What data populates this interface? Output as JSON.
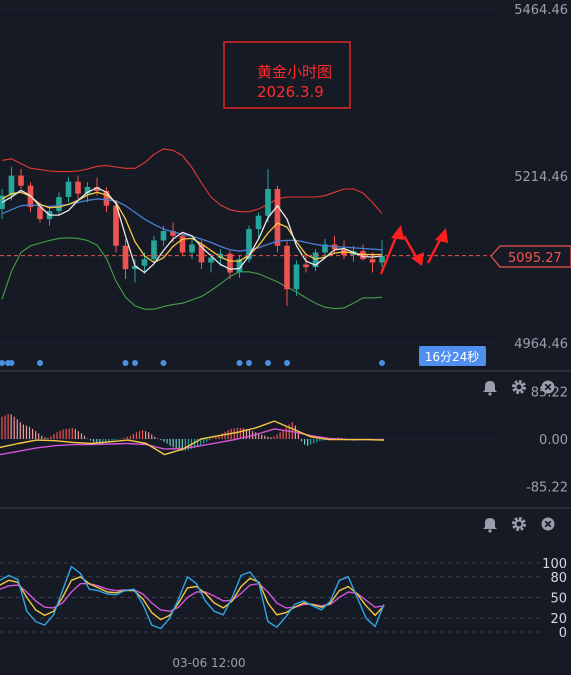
{
  "chart_data": [
    {
      "type": "candlestick",
      "panel": "main",
      "annotation": {
        "line1": "黄金小时图",
        "line2": "2026.3.9"
      },
      "y_ticks": [
        "5464.46",
        "5214.46",
        "4964.46"
      ],
      "y_tick_values": [
        5464.46,
        5214.46,
        4964.46
      ],
      "ylim": [
        4964.46,
        5464.46
      ],
      "price_label": "5095.27",
      "price_value": 5095.27,
      "countdown": "16分24秒",
      "colors": {
        "up": "#26a69a",
        "down": "#ef5350",
        "price_line": "#ef5350",
        "bb_outer": "#e53935",
        "bb_lower": "#43a047",
        "ma_fast": "#e8e8e8",
        "ma_mid": "#f5c842",
        "ma_slow": "#4a7fd6",
        "marker": "#4a90e2"
      },
      "series": [
        {
          "role": "bollinger-upper",
          "values": [
            5238,
            5240,
            5233,
            5226,
            5224,
            5222,
            5221,
            5221,
            5222,
            5225,
            5229,
            5230,
            5228,
            5226,
            5226,
            5234,
            5247,
            5255,
            5253,
            5245,
            5227,
            5204,
            5183,
            5171,
            5164,
            5161,
            5161,
            5165,
            5172,
            5180,
            5183,
            5183,
            5183,
            5183,
            5185,
            5190,
            5195,
            5195,
            5189,
            5175,
            5158
          ]
        },
        {
          "role": "bollinger-lower",
          "values": [
            5030,
            5072,
            5100,
            5110,
            5114,
            5118,
            5121,
            5122,
            5121,
            5118,
            5111,
            5091,
            5057,
            5033,
            5020,
            5015,
            5015,
            5019,
            5022,
            5024,
            5029,
            5034,
            5043,
            5053,
            5064,
            5071,
            5071,
            5068,
            5062,
            5056,
            5048,
            5041,
            5032,
            5024,
            5018,
            5016,
            5017,
            5024,
            5032,
            5032,
            5033
          ]
        },
        {
          "role": "ma-fast",
          "values": [
            5175,
            5183,
            5193,
            5185,
            5169,
            5156,
            5156,
            5163,
            5178,
            5190,
            5197,
            5190,
            5173,
            5125,
            5080,
            5070,
            5083,
            5103,
            5120,
            5130,
            5125,
            5108,
            5095,
            5082,
            5075,
            5076,
            5095,
            5120,
            5152,
            5170,
            5150,
            5110,
            5087,
            5081,
            5092,
            5104,
            5106,
            5100,
            5094,
            5093,
            5095
          ]
        },
        {
          "role": "ma-mid",
          "values": [
            5180,
            5188,
            5190,
            5184,
            5172,
            5167,
            5168,
            5172,
            5178,
            5186,
            5190,
            5186,
            5175,
            5150,
            5116,
            5095,
            5085,
            5092,
            5109,
            5120,
            5121,
            5113,
            5103,
            5093,
            5087,
            5087,
            5096,
            5110,
            5129,
            5144,
            5138,
            5116,
            5097,
            5090,
            5093,
            5099,
            5101,
            5099,
            5097,
            5097,
            5097
          ]
        },
        {
          "role": "ma-slow",
          "values": [
            5158,
            5164,
            5170,
            5171,
            5170,
            5169,
            5170,
            5172,
            5175,
            5178,
            5180,
            5179,
            5177,
            5170,
            5160,
            5150,
            5142,
            5135,
            5131,
            5127,
            5124,
            5120,
            5115,
            5109,
            5104,
            5102,
            5104,
            5107,
            5112,
            5117,
            5118,
            5118,
            5115,
            5112,
            5110,
            5109,
            5108,
            5107,
            5106,
            5105,
            5104
          ]
        }
      ],
      "candles": [
        [
          5165,
          5195,
          5150,
          5185
        ],
        [
          5185,
          5228,
          5178,
          5215
        ],
        [
          5215,
          5225,
          5195,
          5200
        ],
        [
          5200,
          5205,
          5160,
          5168
        ],
        [
          5168,
          5175,
          5145,
          5150
        ],
        [
          5150,
          5168,
          5140,
          5162
        ],
        [
          5162,
          5190,
          5155,
          5183
        ],
        [
          5183,
          5213,
          5175,
          5206
        ],
        [
          5206,
          5215,
          5180,
          5188
        ],
        [
          5188,
          5205,
          5175,
          5198
        ],
        [
          5198,
          5212,
          5185,
          5192
        ],
        [
          5192,
          5198,
          5160,
          5170
        ],
        [
          5170,
          5178,
          5100,
          5110
        ],
        [
          5110,
          5120,
          5060,
          5075
        ],
        [
          5075,
          5090,
          5055,
          5080
        ],
        [
          5080,
          5100,
          5068,
          5090
        ],
        [
          5090,
          5125,
          5085,
          5118
        ],
        [
          5118,
          5140,
          5110,
          5132
        ],
        [
          5132,
          5145,
          5115,
          5125
        ],
        [
          5125,
          5130,
          5095,
          5100
        ],
        [
          5100,
          5120,
          5090,
          5112
        ],
        [
          5112,
          5118,
          5075,
          5085
        ],
        [
          5085,
          5098,
          5070,
          5092
        ],
        [
          5092,
          5105,
          5080,
          5098
        ],
        [
          5098,
          5102,
          5060,
          5070
        ],
        [
          5070,
          5095,
          5062,
          5090
        ],
        [
          5090,
          5140,
          5085,
          5135
        ],
        [
          5135,
          5160,
          5120,
          5155
        ],
        [
          5155,
          5225,
          5145,
          5195
        ],
        [
          5195,
          5200,
          5100,
          5110
        ],
        [
          5110,
          5118,
          5020,
          5045
        ],
        [
          5045,
          5088,
          5035,
          5082
        ],
        [
          5082,
          5095,
          5070,
          5078
        ],
        [
          5078,
          5105,
          5072,
          5100
        ],
        [
          5100,
          5120,
          5092,
          5112
        ],
        [
          5112,
          5125,
          5100,
          5105
        ],
        [
          5105,
          5118,
          5090,
          5096
        ],
        [
          5096,
          5110,
          5086,
          5102
        ],
        [
          5102,
          5112,
          5088,
          5090
        ],
        [
          5090,
          5100,
          5070,
          5085
        ],
        [
          5085,
          5118,
          5078,
          5095
        ]
      ],
      "markers_at": [
        0,
        1,
        4,
        13,
        14,
        17,
        25,
        26,
        28,
        30,
        40
      ]
    },
    {
      "type": "histogram",
      "panel": "macd",
      "y_ticks": [
        "85.22",
        "0.00",
        "-85.22"
      ],
      "y_tick_values": [
        85.22,
        0,
        -85.22
      ],
      "ylim": [
        -120,
        120
      ],
      "series": [
        {
          "role": "macd-histogram",
          "values": [
            40,
            42,
            45,
            44,
            40,
            35,
            30,
            26,
            24,
            22,
            18,
            14,
            10,
            6,
            3,
            2,
            5,
            9,
            12,
            15,
            17,
            18,
            19,
            20,
            18,
            14,
            10,
            6,
            1,
            -3,
            -6,
            -8,
            -10,
            -9,
            -7,
            -5,
            -3,
            -2,
            -1,
            1,
            2,
            4,
            6,
            9,
            12,
            14,
            16,
            14,
            12,
            8,
            4,
            1,
            -2,
            -5,
            -8,
            -12,
            -15,
            -18,
            -20,
            -21,
            -21,
            -20,
            -18,
            -16,
            -14,
            -11,
            -8,
            -5,
            -2,
            1,
            4,
            7,
            10,
            13,
            16,
            18,
            19,
            20,
            20,
            19,
            18,
            16,
            14,
            12,
            10,
            8,
            6,
            4,
            3,
            5,
            8,
            12,
            17,
            22,
            26,
            30,
            24,
            10,
            -4,
            -10,
            -12,
            -10,
            -8,
            -6,
            -4,
            -3,
            -2,
            -1,
            1,
            2,
            3,
            2,
            1,
            -1,
            -2,
            -3,
            -3,
            -2,
            -1,
            0,
            1,
            1,
            0,
            -1,
            -1,
            0
          ]
        },
        {
          "role": "macd-line",
          "values": [
            -15,
            -8,
            -2,
            -3,
            -6,
            -8,
            -5,
            -2,
            -8,
            -28,
            -18,
            0,
            6,
            12,
            20,
            32,
            18,
            4,
            -1,
            -1,
            -1,
            -2
          ]
        },
        {
          "role": "signal-line",
          "values": [
            -28,
            -22,
            -16,
            -12,
            -10,
            -10,
            -9,
            -8,
            -10,
            -18,
            -17,
            -12,
            -6,
            0,
            8,
            18,
            13,
            6,
            1,
            -1,
            -1,
            -1
          ]
        }
      ]
    },
    {
      "type": "line",
      "panel": "stochastic",
      "y_ticks": [
        "100",
        "80",
        "50",
        "20",
        "0"
      ],
      "y_tick_values": [
        100,
        80,
        50,
        20,
        0
      ],
      "ylim": [
        0,
        100
      ],
      "x_tick_label": "03-06 12:00",
      "series": [
        {
          "role": "stoch-fast",
          "values": [
            75,
            82,
            76,
            30,
            15,
            10,
            25,
            60,
            95,
            85,
            62,
            60,
            55,
            54,
            60,
            62,
            40,
            10,
            5,
            20,
            48,
            80,
            70,
            45,
            30,
            25,
            50,
            82,
            87,
            70,
            15,
            7,
            22,
            40,
            45,
            38,
            32,
            45,
            75,
            80,
            50,
            20,
            8,
            40
          ]
        },
        {
          "role": "stoch-k",
          "values": [
            68,
            75,
            72,
            50,
            32,
            24,
            30,
            50,
            75,
            80,
            70,
            64,
            58,
            57,
            60,
            60,
            48,
            28,
            18,
            24,
            42,
            64,
            66,
            56,
            42,
            35,
            45,
            66,
            78,
            72,
            42,
            25,
            28,
            36,
            42,
            40,
            36,
            42,
            60,
            66,
            55,
            38,
            24,
            38
          ]
        },
        {
          "role": "stoch-d",
          "values": [
            62,
            67,
            68,
            58,
            45,
            36,
            35,
            42,
            58,
            70,
            70,
            67,
            62,
            60,
            61,
            61,
            55,
            42,
            32,
            30,
            36,
            50,
            58,
            58,
            52,
            45,
            46,
            56,
            68,
            70,
            58,
            42,
            35,
            36,
            40,
            40,
            38,
            40,
            50,
            58,
            56,
            46,
            36,
            38
          ]
        }
      ]
    }
  ],
  "icons": [
    "bell-icon",
    "gear-icon",
    "close-icon"
  ]
}
